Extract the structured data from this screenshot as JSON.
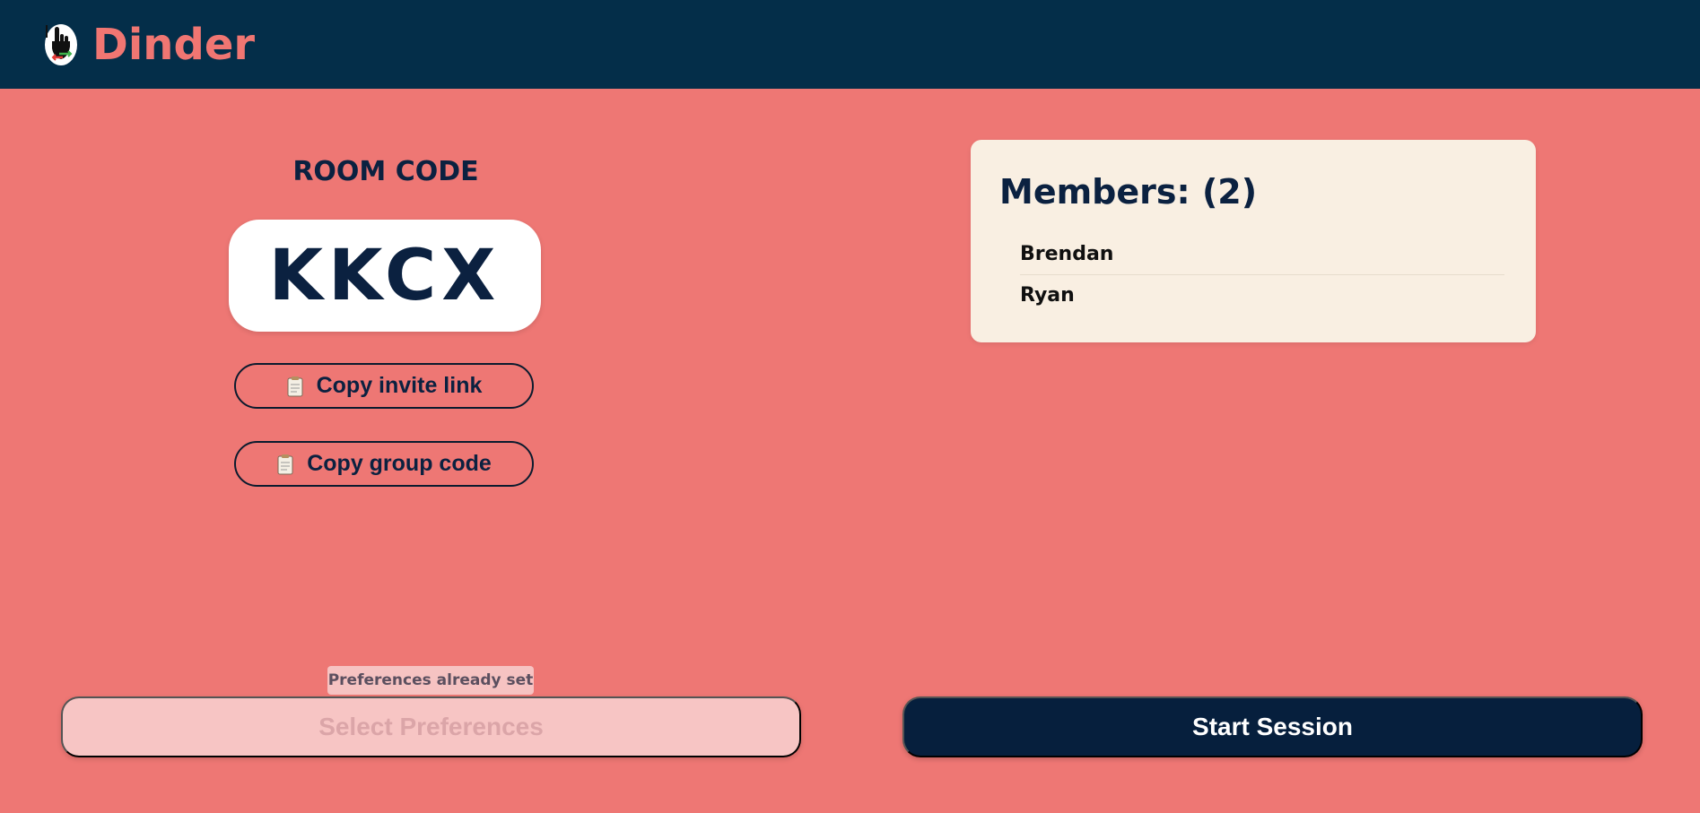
{
  "header": {
    "brand": "Dinder",
    "logo_icon": "pointing-hand-fork-icon",
    "background_color": "#042e49",
    "brand_color": "#f07672"
  },
  "room": {
    "label": "ROOM CODE",
    "code": "KKCX"
  },
  "actions": {
    "copy_invite_label": "Copy invite link",
    "copy_group_label": "Copy group code",
    "clipboard_icon": "clipboard-icon"
  },
  "members": {
    "title": "Members: (2)",
    "list": [
      "Brendan",
      "Ryan"
    ]
  },
  "footer": {
    "preferences_note": "Preferences already set",
    "select_preferences_label": "Select Preferences",
    "start_session_label": "Start Session"
  },
  "colors": {
    "page_background": "#ee7774",
    "accent_dark": "#061f3d",
    "card_background": "#f9efe2"
  }
}
